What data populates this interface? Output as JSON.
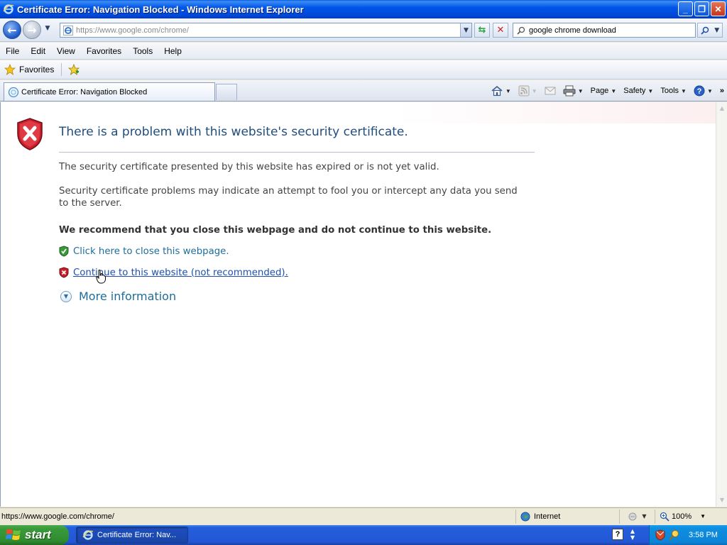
{
  "window": {
    "title": "Certificate Error: Navigation Blocked - Windows Internet Explorer",
    "buttons": {
      "minimize": "_",
      "maximize": "❐",
      "close": "✕"
    }
  },
  "nav": {
    "url": "https://www.google.com/chrome/",
    "search_query": "google chrome download"
  },
  "menu": {
    "items": [
      "File",
      "Edit",
      "View",
      "Favorites",
      "Tools",
      "Help"
    ]
  },
  "favorites_bar": {
    "label": "Favorites"
  },
  "tabs": [
    {
      "label": "Certificate Error: Navigation Blocked",
      "active": true
    }
  ],
  "command_bar": {
    "page": "Page",
    "safety": "Safety",
    "tools": "Tools"
  },
  "content": {
    "title": "There is a problem with this website's security certificate.",
    "para1": "The security certificate presented by this website has expired or is not yet valid.",
    "para2": "Security certificate problems may indicate an attempt to fool you or intercept any data you send to the server.",
    "recommend": "We recommend that you close this webpage and do not continue to this website.",
    "close_link": "Click here to close this webpage.",
    "continue_link": "Continue to this website (not recommended).",
    "more_info": "More information"
  },
  "status_bar": {
    "url": "https://www.google.com/chrome/",
    "zone": "Internet",
    "zoom": "100%"
  },
  "taskbar": {
    "start_label": "start",
    "task_label": "Certificate Error: Nav...",
    "clock": "3:58 PM"
  },
  "colors": {
    "title_blue": "#1f4d7d",
    "link_teal": "#1f6d99",
    "xp_taskbar": "#245edb",
    "start_green": "#3a9a3a"
  }
}
